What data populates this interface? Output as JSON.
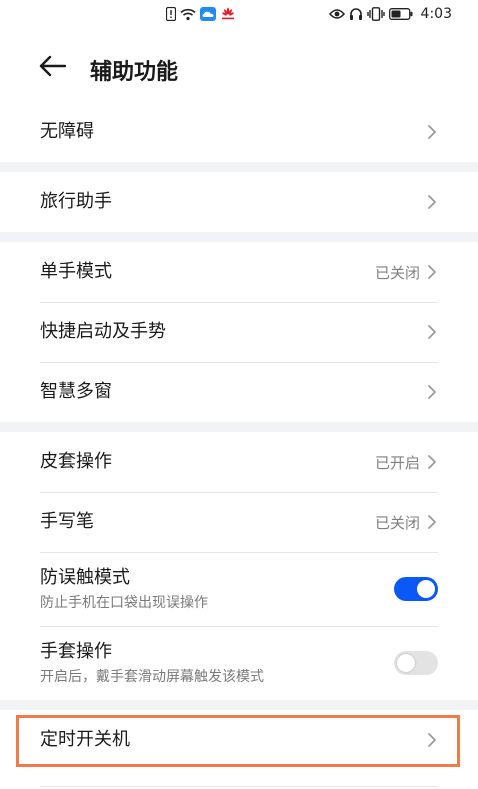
{
  "status_bar": {
    "time": "4:03",
    "left_icons": [
      "alert-icon",
      "wifi-icon",
      "cloud-icon",
      "huawei-logo-icon"
    ],
    "right_icons": [
      "eye-icon",
      "headphones-icon",
      "vibrate-icon",
      "battery-icon"
    ]
  },
  "header": {
    "title": "辅助功能",
    "back_icon": "arrow-left-icon"
  },
  "groups": [
    {
      "items": [
        {
          "label": "无障碍"
        }
      ]
    },
    {
      "items": [
        {
          "label": "旅行助手"
        }
      ]
    },
    {
      "items": [
        {
          "label": "单手模式",
          "value": "已关闭"
        },
        {
          "label": "快捷启动及手势"
        },
        {
          "label": "智慧多窗"
        }
      ]
    },
    {
      "items": [
        {
          "label": "皮套操作",
          "value": "已开启"
        },
        {
          "label": "手写笔",
          "value": "已关闭"
        },
        {
          "label": "防误触模式",
          "sub": "防止手机在口袋出现误操作",
          "toggle": true
        },
        {
          "label": "手套操作",
          "sub": "开启后，戴手套滑动屏幕触发该模式",
          "toggle": false
        }
      ]
    },
    {
      "items": [
        {
          "label": "定时开关机"
        }
      ]
    }
  ],
  "colors": {
    "accent": "#0a59f7",
    "highlight": "#f07a4a",
    "background": "#f1f3f5"
  }
}
